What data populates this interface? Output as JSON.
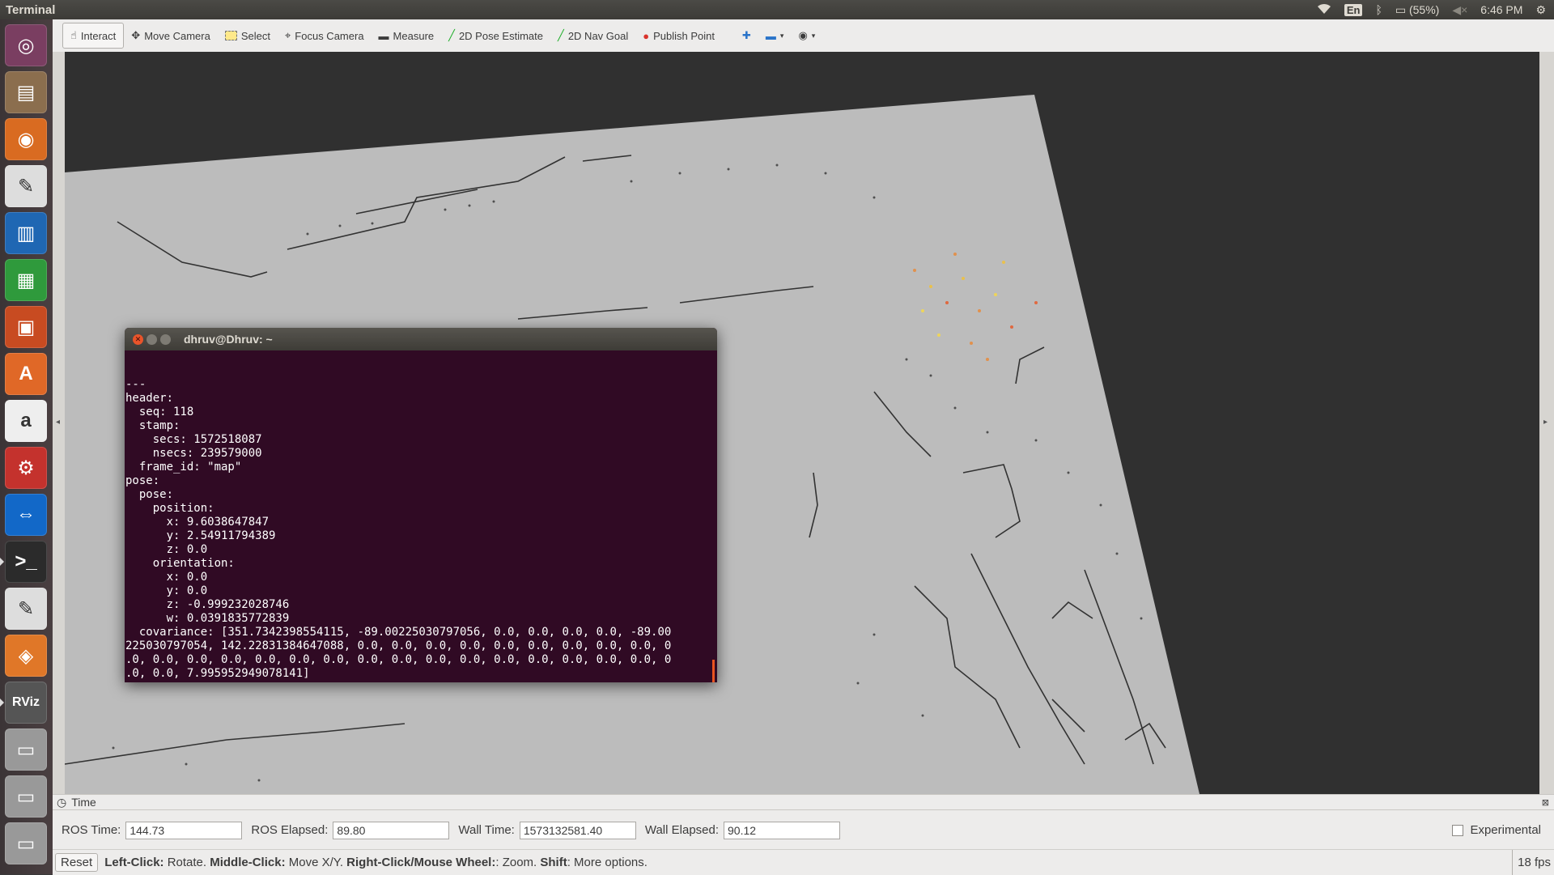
{
  "topbar": {
    "title": "Terminal",
    "lang": "En",
    "battery": "(55%)",
    "time": "6:46 PM"
  },
  "launcher": {
    "items": [
      {
        "name": "ubuntu-dash",
        "glyph": "◎",
        "color": "#7a3e61"
      },
      {
        "name": "files",
        "glyph": "▤",
        "color": "#8b6e4e"
      },
      {
        "name": "firefox",
        "glyph": "◉",
        "color": "#d96b21"
      },
      {
        "name": "text-editor",
        "glyph": "✎",
        "color": "#ddd"
      },
      {
        "name": "writer",
        "glyph": "▥",
        "color": "#1f67b3"
      },
      {
        "name": "calc",
        "glyph": "▦",
        "color": "#2f9a3c"
      },
      {
        "name": "impress",
        "glyph": "▣",
        "color": "#c84b21"
      },
      {
        "name": "software-center",
        "glyph": "A",
        "color": "#e06827"
      },
      {
        "name": "amazon",
        "glyph": "a",
        "color": "#eee"
      },
      {
        "name": "settings",
        "glyph": "⚙",
        "color": "#c4322d"
      },
      {
        "name": "teamviewer",
        "glyph": "⇔",
        "color": "#1268c8"
      },
      {
        "name": "terminal",
        "glyph": ">_",
        "color": "#2b2b2b"
      },
      {
        "name": "text-editor-2",
        "glyph": "✎",
        "color": "#ddd"
      },
      {
        "name": "package",
        "glyph": "◈",
        "color": "#e07728"
      },
      {
        "name": "rviz",
        "glyph": "RViz",
        "color": "#555"
      },
      {
        "name": "disk",
        "glyph": "▭",
        "color": "#999"
      },
      {
        "name": "disk-2",
        "glyph": "▭",
        "color": "#999"
      },
      {
        "name": "disk-3",
        "glyph": "▭",
        "color": "#999"
      }
    ]
  },
  "toolbar": {
    "interact": "Interact",
    "move_camera": "Move Camera",
    "select": "Select",
    "focus_camera": "Focus Camera",
    "measure": "Measure",
    "pose_estimate": "2D Pose Estimate",
    "nav_goal": "2D Nav Goal",
    "publish_point": "Publish Point"
  },
  "terminal": {
    "title": "dhruv@Dhruv: ~",
    "output": "---\nheader:\n  seq: 118\n  stamp:\n    secs: 1572518087\n    nsecs: 239579000\n  frame_id: \"map\"\npose:\n  pose:\n    position:\n      x: 9.6038647847\n      y: 2.54911794389\n      z: 0.0\n    orientation:\n      x: 0.0\n      y: 0.0\n      z: -0.999232028746\n      w: 0.0391835772839\n  covariance: [351.7342398554115, -89.00225030797056, 0.0, 0.0, 0.0, 0.0, -89.00\n225030797054, 142.22831384647088, 0.0, 0.0, 0.0, 0.0, 0.0, 0.0, 0.0, 0.0, 0.0, 0\n.0, 0.0, 0.0, 0.0, 0.0, 0.0, 0.0, 0.0, 0.0, 0.0, 0.0, 0.0, 0.0, 0.0, 0.0, 0.0, 0\n.0, 0.0, 7.995952949078141]\n---"
  },
  "time_panel": {
    "header": "Time",
    "ros_time_label": "ROS Time:",
    "ros_time": "144.73",
    "ros_elapsed_label": "ROS Elapsed:",
    "ros_elapsed": "89.80",
    "wall_time_label": "Wall Time:",
    "wall_time": "1573132581.40",
    "wall_elapsed_label": "Wall Elapsed:",
    "wall_elapsed": "90.12",
    "experimental_label": "Experimental"
  },
  "status": {
    "reset": "Reset",
    "left_click": "Left-Click:",
    "left_click_desc": " Rotate. ",
    "middle_click": "Middle-Click:",
    "middle_click_desc": " Move X/Y. ",
    "right_click": "Right-Click/Mouse Wheel:",
    "right_click_desc": ": Zoom. ",
    "shift": "Shift",
    "shift_desc": ": More options.",
    "fps": "18 fps"
  }
}
